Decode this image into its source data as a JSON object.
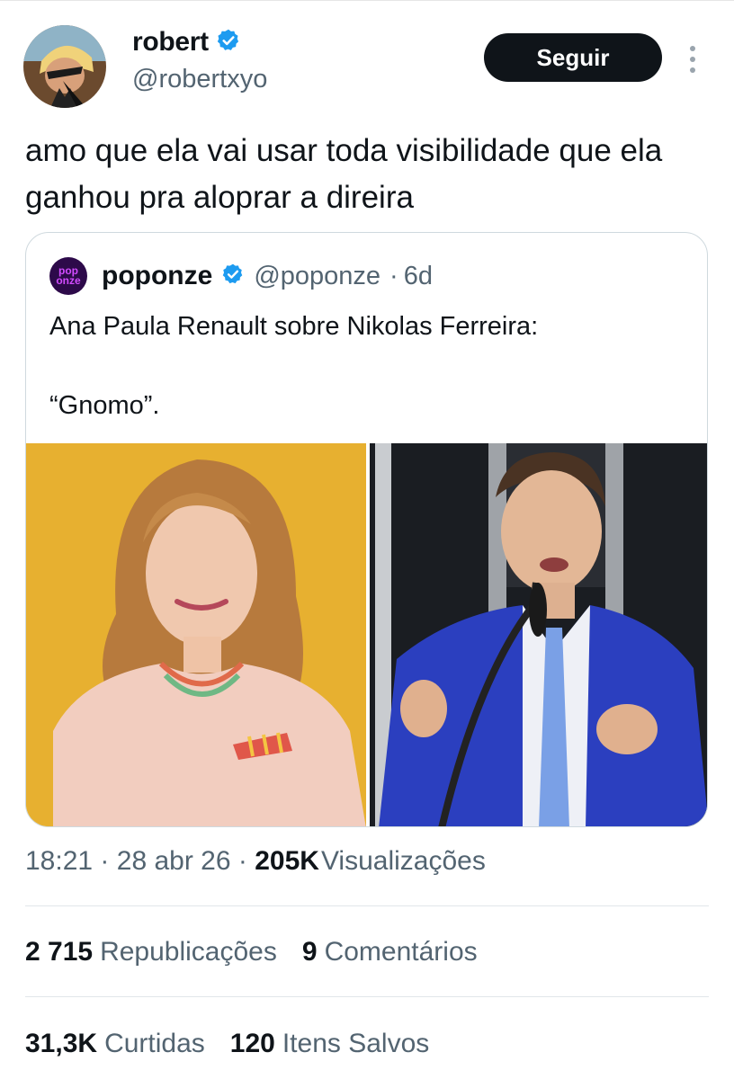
{
  "author": {
    "display_name": "robert",
    "handle": "@robertxyo",
    "verified": true,
    "avatar_icon": "anime-character-avatar"
  },
  "actions": {
    "follow_label": "Seguir",
    "more_icon": "more-vertical-icon"
  },
  "tweet": {
    "text": "amo que ela vai usar toda visibilidade que ela ganhou pra aloprar a direira"
  },
  "quoted_tweet": {
    "display_name": "poponze",
    "handle": "@poponze",
    "separator": "·",
    "age": "6d",
    "verified": true,
    "avatar_text_top": "pop",
    "avatar_text_bottom": "onze",
    "text_line1": "Ana Paula Renault sobre Nikolas Ferreira:",
    "text_line2": "“Gnomo”."
  },
  "meta": {
    "time": "18:21",
    "sep": "·",
    "date": "28 abr 26",
    "views_count": "205K",
    "views_label": "Visualizações"
  },
  "stats": {
    "reposts_count": "2 715",
    "reposts_label": "Republicações",
    "comments_count": "9",
    "comments_label": "Comentários",
    "likes_count": "31,3K",
    "likes_label": "Curtidas",
    "saves_count": "120",
    "saves_label": "Itens Salvos"
  },
  "colors": {
    "verified": "#1d9bf0",
    "text_primary": "#0f1419",
    "text_secondary": "#536471",
    "border": "#cfd9de",
    "button_bg": "#0f1419",
    "left_photo_bg": "#e7b030",
    "right_photo_bg": "#1a1d22"
  }
}
